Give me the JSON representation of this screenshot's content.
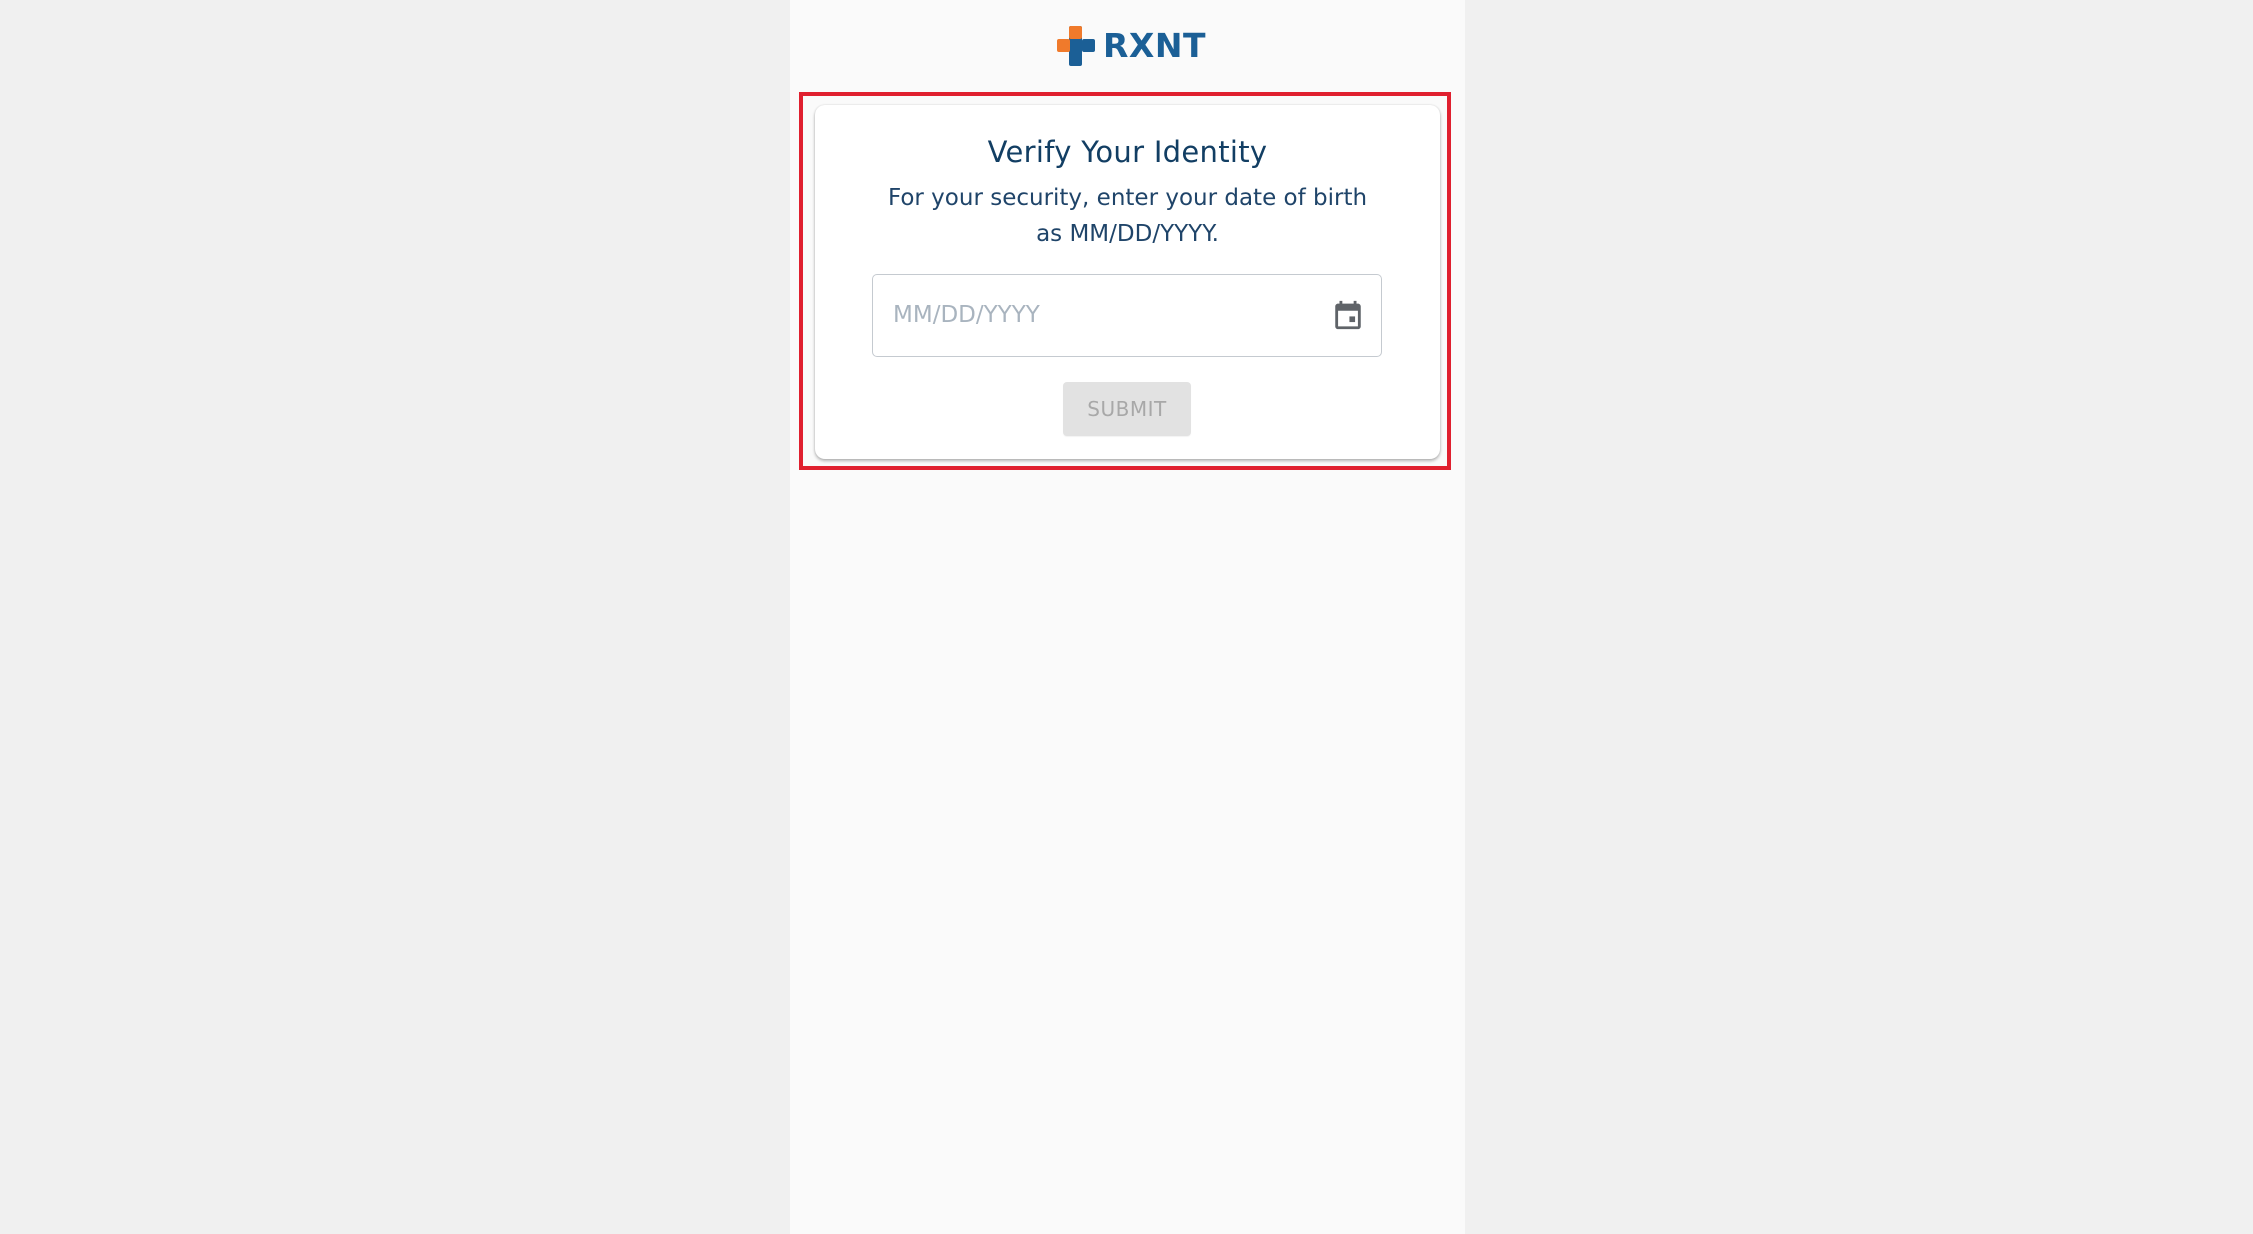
{
  "brand": {
    "name": "RXNT",
    "logo_icon": "medical-cross-icon",
    "colors": {
      "orange": "#f07a2b",
      "blue": "#1b5f96",
      "navy": "#123e63"
    }
  },
  "card": {
    "title": "Verify Your Identity",
    "description": "For your security, enter your date of birth as MM/DD/YYYY."
  },
  "dob_input": {
    "value": "",
    "placeholder": "MM/DD/YYYY",
    "icon": "calendar-icon"
  },
  "submit": {
    "label": "SUBMIT",
    "state": "disabled"
  },
  "highlight_color": "#e0202f"
}
